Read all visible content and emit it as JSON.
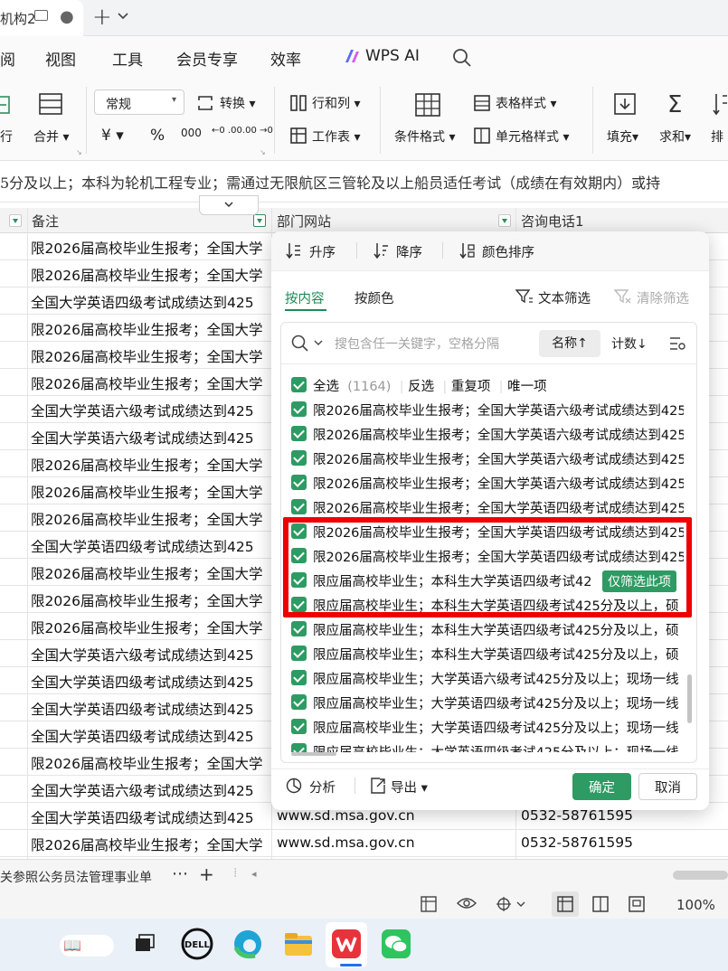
{
  "tab": {
    "title": "机构2",
    "close": "●",
    "add": "+",
    "menu": "⌄"
  },
  "menu": {
    "items": [
      "阅",
      "视图",
      "工具",
      "会员专享",
      "效率",
      "WPS AI"
    ]
  },
  "ribbon": {
    "row_label": "行",
    "merge_label": "合并",
    "number_format": "常规",
    "convert_label": "转换",
    "currency": "¥",
    "percent": "%",
    "thousands": "000",
    "dec_inc": "←0 .00",
    "dec_dec": ".00 →0",
    "rowcol_label": "行和列",
    "worksheet_label": "工作表",
    "cond_format_label": "条件格式",
    "table_style_label": "表格样式",
    "cell_style_label": "单元格样式",
    "fill_label": "填充",
    "sum_label": "求和",
    "sort_label": "排"
  },
  "formula": {
    "text": "5分及以上；本科为轮机工程专业；需通过无限航区三管轮及以上船员适任考试（成绩在有效期内）或持"
  },
  "columns": {
    "remark": "备注",
    "website": "部门网站",
    "phone": "咨询电话1"
  },
  "rows": [
    {
      "remark": "限2026届高校毕业生报考；全国大学"
    },
    {
      "remark": "限2026届高校毕业生报考；全国大学"
    },
    {
      "remark": "全国大学英语四级考试成绩达到425"
    },
    {
      "remark": "限2026届高校毕业生报考；全国大学"
    },
    {
      "remark": "限2026届高校毕业生报考；全国大学"
    },
    {
      "remark": "限2026届高校毕业生报考；全国大学"
    },
    {
      "remark": "全国大学英语六级考试成绩达到425"
    },
    {
      "remark": "全国大学英语六级考试成绩达到425"
    },
    {
      "remark": "限2026届高校毕业生报考；全国大学"
    },
    {
      "remark": "限2026届高校毕业生报考；全国大学"
    },
    {
      "remark": "限2026届高校毕业生报考；全国大学"
    },
    {
      "remark": "全国大学英语四级考试成绩达到425"
    },
    {
      "remark": "限2026届高校毕业生报考；全国大学"
    },
    {
      "remark": "限2026届高校毕业生报考；全国大学"
    },
    {
      "remark": "限2026届高校毕业生报考；全国大学"
    },
    {
      "remark": "全国大学英语六级考试成绩达到425"
    },
    {
      "remark": "全国大学英语四级考试成绩达到425"
    },
    {
      "remark": "全国大学英语四级考试成绩达到425"
    },
    {
      "remark": "全国大学英语四级考试成绩达到425"
    },
    {
      "remark": "限2026届高校毕业生报考；全国大学"
    },
    {
      "remark": "全国大学英语六级考试成绩达到425"
    },
    {
      "remark": "全国大学英语四级考试成绩达到425",
      "website": "www.sd.msa.gov.cn",
      "phone": "0532-58761595"
    },
    {
      "remark": "限2026届高校毕业生报考；全国大学",
      "website": "www.sd.msa.gov.cn",
      "phone": "0532-58761595"
    }
  ],
  "sheet": {
    "name": "关参照公务员法管理事业单",
    "more": "⋯",
    "add": "+"
  },
  "status": {
    "zoom": "100%"
  },
  "popup": {
    "sort_asc": "升序",
    "sort_desc": "降序",
    "sort_color": "颜色排序",
    "tab_content": "按内容",
    "tab_color": "按颜色",
    "text_filter": "文本筛选",
    "clear_filter": "清除筛选",
    "search_placeholder": "搜包含任一关键字，空格分隔",
    "sort_name": "名称↑",
    "sort_count": "计数↓",
    "select_all": "全选",
    "select_all_count": "(1164)",
    "invert": "反选",
    "duplicates": "重复项",
    "unique": "唯一项",
    "items": [
      "限2026届高校毕业生报考；全国大学英语六级考试成绩达到425分及以上",
      "限2026届高校毕业生报考；全国大学英语六级考试成绩达到425分及以上",
      "限2026届高校毕业生报考；全国大学英语六级考试成绩达到425分及以上",
      "限2026届高校毕业生报考；全国大学英语六级考试成绩达到425分及以上",
      "限2026届高校毕业生报考；全国大学英语四级考试成绩达到425分及以上",
      "限2026届高校毕业生报考；全国大学英语四级考试成绩达到425分及以上",
      "限2026届高校毕业生报考；全国大学英语四级考试成绩达到425分及以上",
      "限应届高校毕业生；本科生大学英语四级考试42",
      "限应届高校毕业生；本科生大学英语四级考试425分及以上，硕",
      "限应届高校毕业生；本科生大学英语四级考试425分及以上，硕",
      "限应届高校毕业生；本科生大学英语四级考试425分及以上，硕",
      "限应届高校毕业生；大学英语六级考试425分及以上；现场一线",
      "限应届高校毕业生；大学英语四级考试425分及以上；现场一线",
      "限应届高校毕业生；大学英语四级考试425分及以上；现场一线",
      "限应届高校毕业生；大学英语四级考试425分及以上；现场一线"
    ],
    "only_this": "仅筛选此项",
    "analyze": "分析",
    "export": "导出",
    "ok": "确定",
    "cancel": "取消"
  }
}
